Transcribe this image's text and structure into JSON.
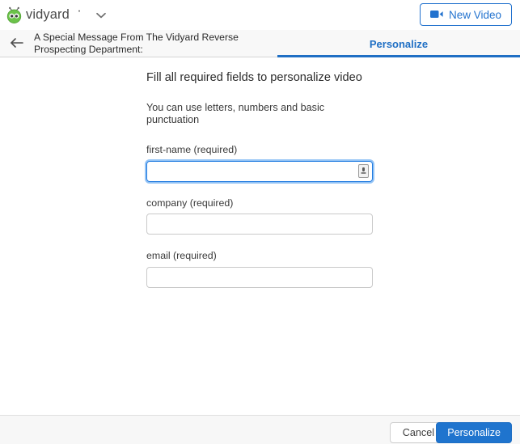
{
  "brand": {
    "name": "vidyard",
    "logo_icon": "vidyard-mascot-icon",
    "accent_green": "#6cc24a",
    "accent_blue": "#1f74ce",
    "dropdown_icon": "chevron-down-icon"
  },
  "topbar": {
    "new_video_label": "New Video",
    "new_video_icon": "video-camera-icon"
  },
  "titlebar": {
    "back_icon": "arrow-left-icon",
    "document_title": "A Special Message From The Vidyard Reverse Prospecting Department:",
    "tab_label": "Personalize"
  },
  "main": {
    "headline": "Fill all required fields to personalize video",
    "subline": "You can use letters, numbers and basic punctuation",
    "fields": [
      {
        "label": "first-name (required)",
        "value": "",
        "placeholder": "",
        "focused": true,
        "addon_icon": "text-input-indicator-icon"
      },
      {
        "label": "company (required)",
        "value": "",
        "placeholder": "",
        "focused": false
      },
      {
        "label": "email (required)",
        "value": "",
        "placeholder": "",
        "focused": false
      }
    ]
  },
  "footer": {
    "cancel_label": "Cancel",
    "personalize_label": "Personalize"
  }
}
